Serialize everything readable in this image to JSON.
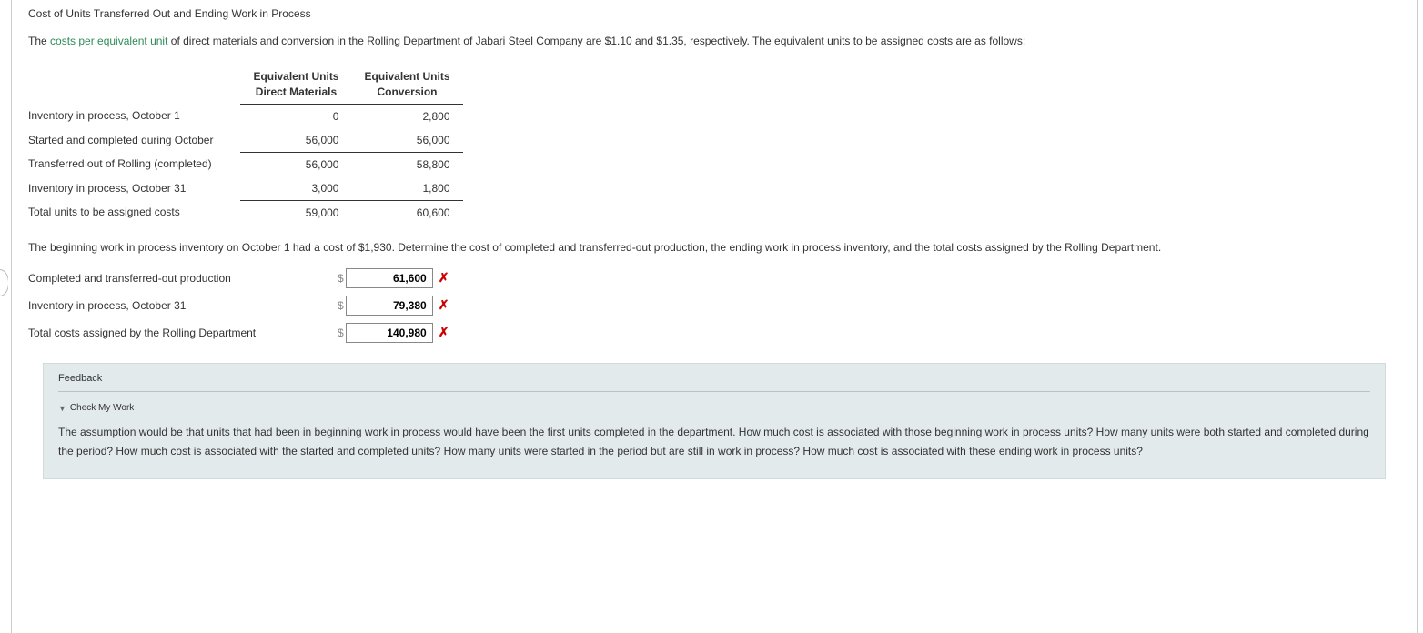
{
  "title": "Cost of Units Transferred Out and Ending Work in Process",
  "intro_pre": "The ",
  "intro_link": "costs per equivalent unit",
  "intro_post": " of direct materials and conversion in the Rolling Department of Jabari Steel Company are $1.10 and $1.35, respectively. The equivalent units to be assigned costs are as follows:",
  "table": {
    "header_col1_l1": "Equivalent Units",
    "header_col1_l2": "Direct Materials",
    "header_col2_l1": "Equivalent Units",
    "header_col2_l2": "Conversion",
    "rows": [
      {
        "label": "Inventory in process, October 1",
        "dm": "0",
        "conv": "2,800"
      },
      {
        "label": "Started and completed during October",
        "dm": "56,000",
        "conv": "56,000"
      },
      {
        "label": "Transferred out of Rolling (completed)",
        "dm": "56,000",
        "conv": "58,800"
      },
      {
        "label": "Inventory in process, October 31",
        "dm": "3,000",
        "conv": "1,800"
      },
      {
        "label": "Total units to be assigned costs",
        "dm": "59,000",
        "conv": "60,600"
      }
    ]
  },
  "para2": "The beginning work in process inventory on October 1 had a cost of $1,930. Determine the cost of completed and transferred-out production, the ending work in process inventory, and the total costs assigned by the Rolling Department.",
  "answers": [
    {
      "label": "Completed and transferred-out production",
      "value": "61,600",
      "mark": "✗"
    },
    {
      "label": "Inventory in process, October 31",
      "value": "79,380",
      "mark": "✗"
    },
    {
      "label": "Total costs assigned by the Rolling Department",
      "value": "140,980",
      "mark": "✗"
    }
  ],
  "feedback": {
    "title": "Feedback",
    "check_label": "Check My Work",
    "body": "The assumption would be that units that had been in beginning work in process would have been the first units completed in the department. How much cost is associated with those beginning work in process units? How many units were both started and completed during the period? How much cost is associated with the started and completed units? How many units were started in the period but are still in work in process? How much cost is associated with these ending work in process units?"
  },
  "dollar": "$"
}
